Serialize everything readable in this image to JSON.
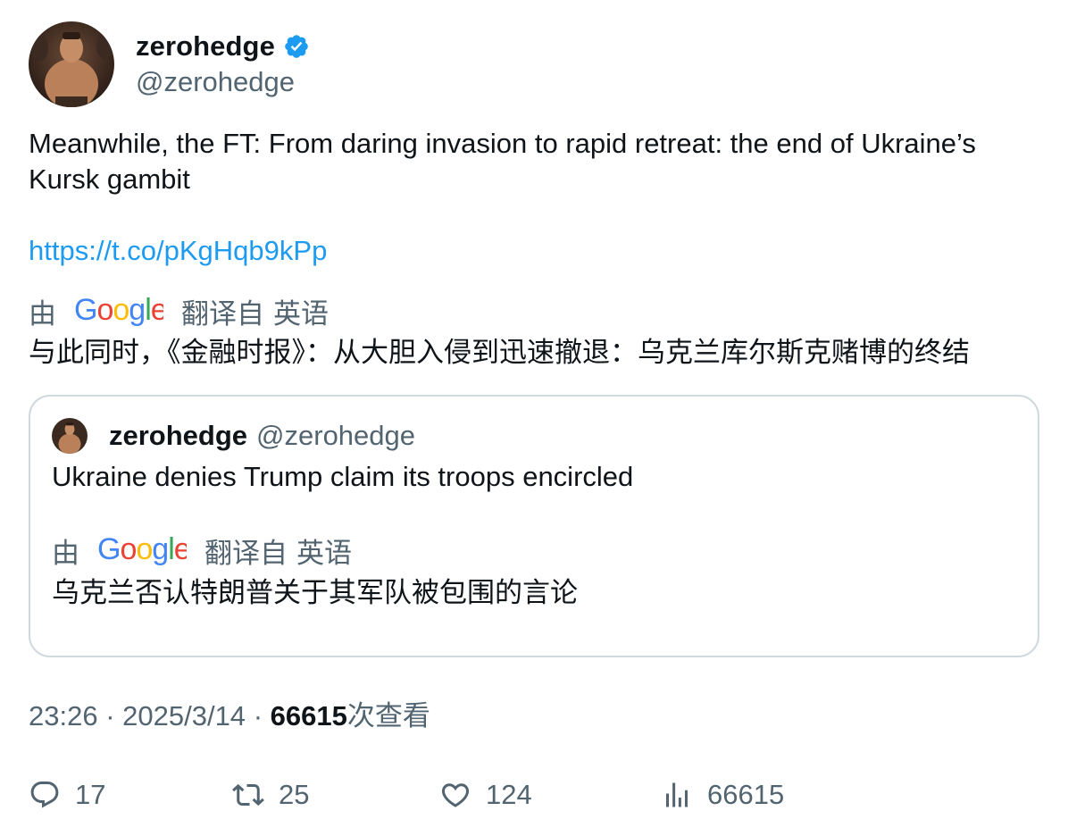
{
  "tweet": {
    "author": {
      "display_name": "zerohedge",
      "handle": "@zerohedge",
      "verified": true,
      "avatar_icon": "avatar-photo"
    },
    "text": "Meanwhile, the FT: From daring invasion to rapid retreat: the end of Ukraine’s Kursk gambit",
    "link": "https://t.co/pKgHqb9kPp",
    "translation": {
      "by_label": "由",
      "provider": "Google",
      "translated_from": "翻译自",
      "language": "英语",
      "text": "与此同时，《金融时报》：从大胆入侵到迅速撤退：乌克兰库尔斯克赌博的终结"
    },
    "quoted": {
      "display_name": "zerohedge",
      "handle": "@zerohedge",
      "text": "Ukraine denies Trump claim its troops encircled",
      "translation": {
        "by_label": "由",
        "provider": "Google",
        "translated_from": "翻译自",
        "language": "英语",
        "text": "乌克兰否认特朗普关于其军队被包围的言论"
      }
    },
    "meta": {
      "time": "23:26",
      "separator": "·",
      "date": "2025/3/14",
      "views_count": "66615",
      "views_label": "次查看"
    },
    "actions": {
      "replies": "17",
      "retweets": "25",
      "likes": "124",
      "views": "66615"
    },
    "colors": {
      "text": "#0f1419",
      "secondary": "#536471",
      "link": "#1d9bf0",
      "verified": "#1d9bf0",
      "border": "#cfd9de"
    }
  }
}
